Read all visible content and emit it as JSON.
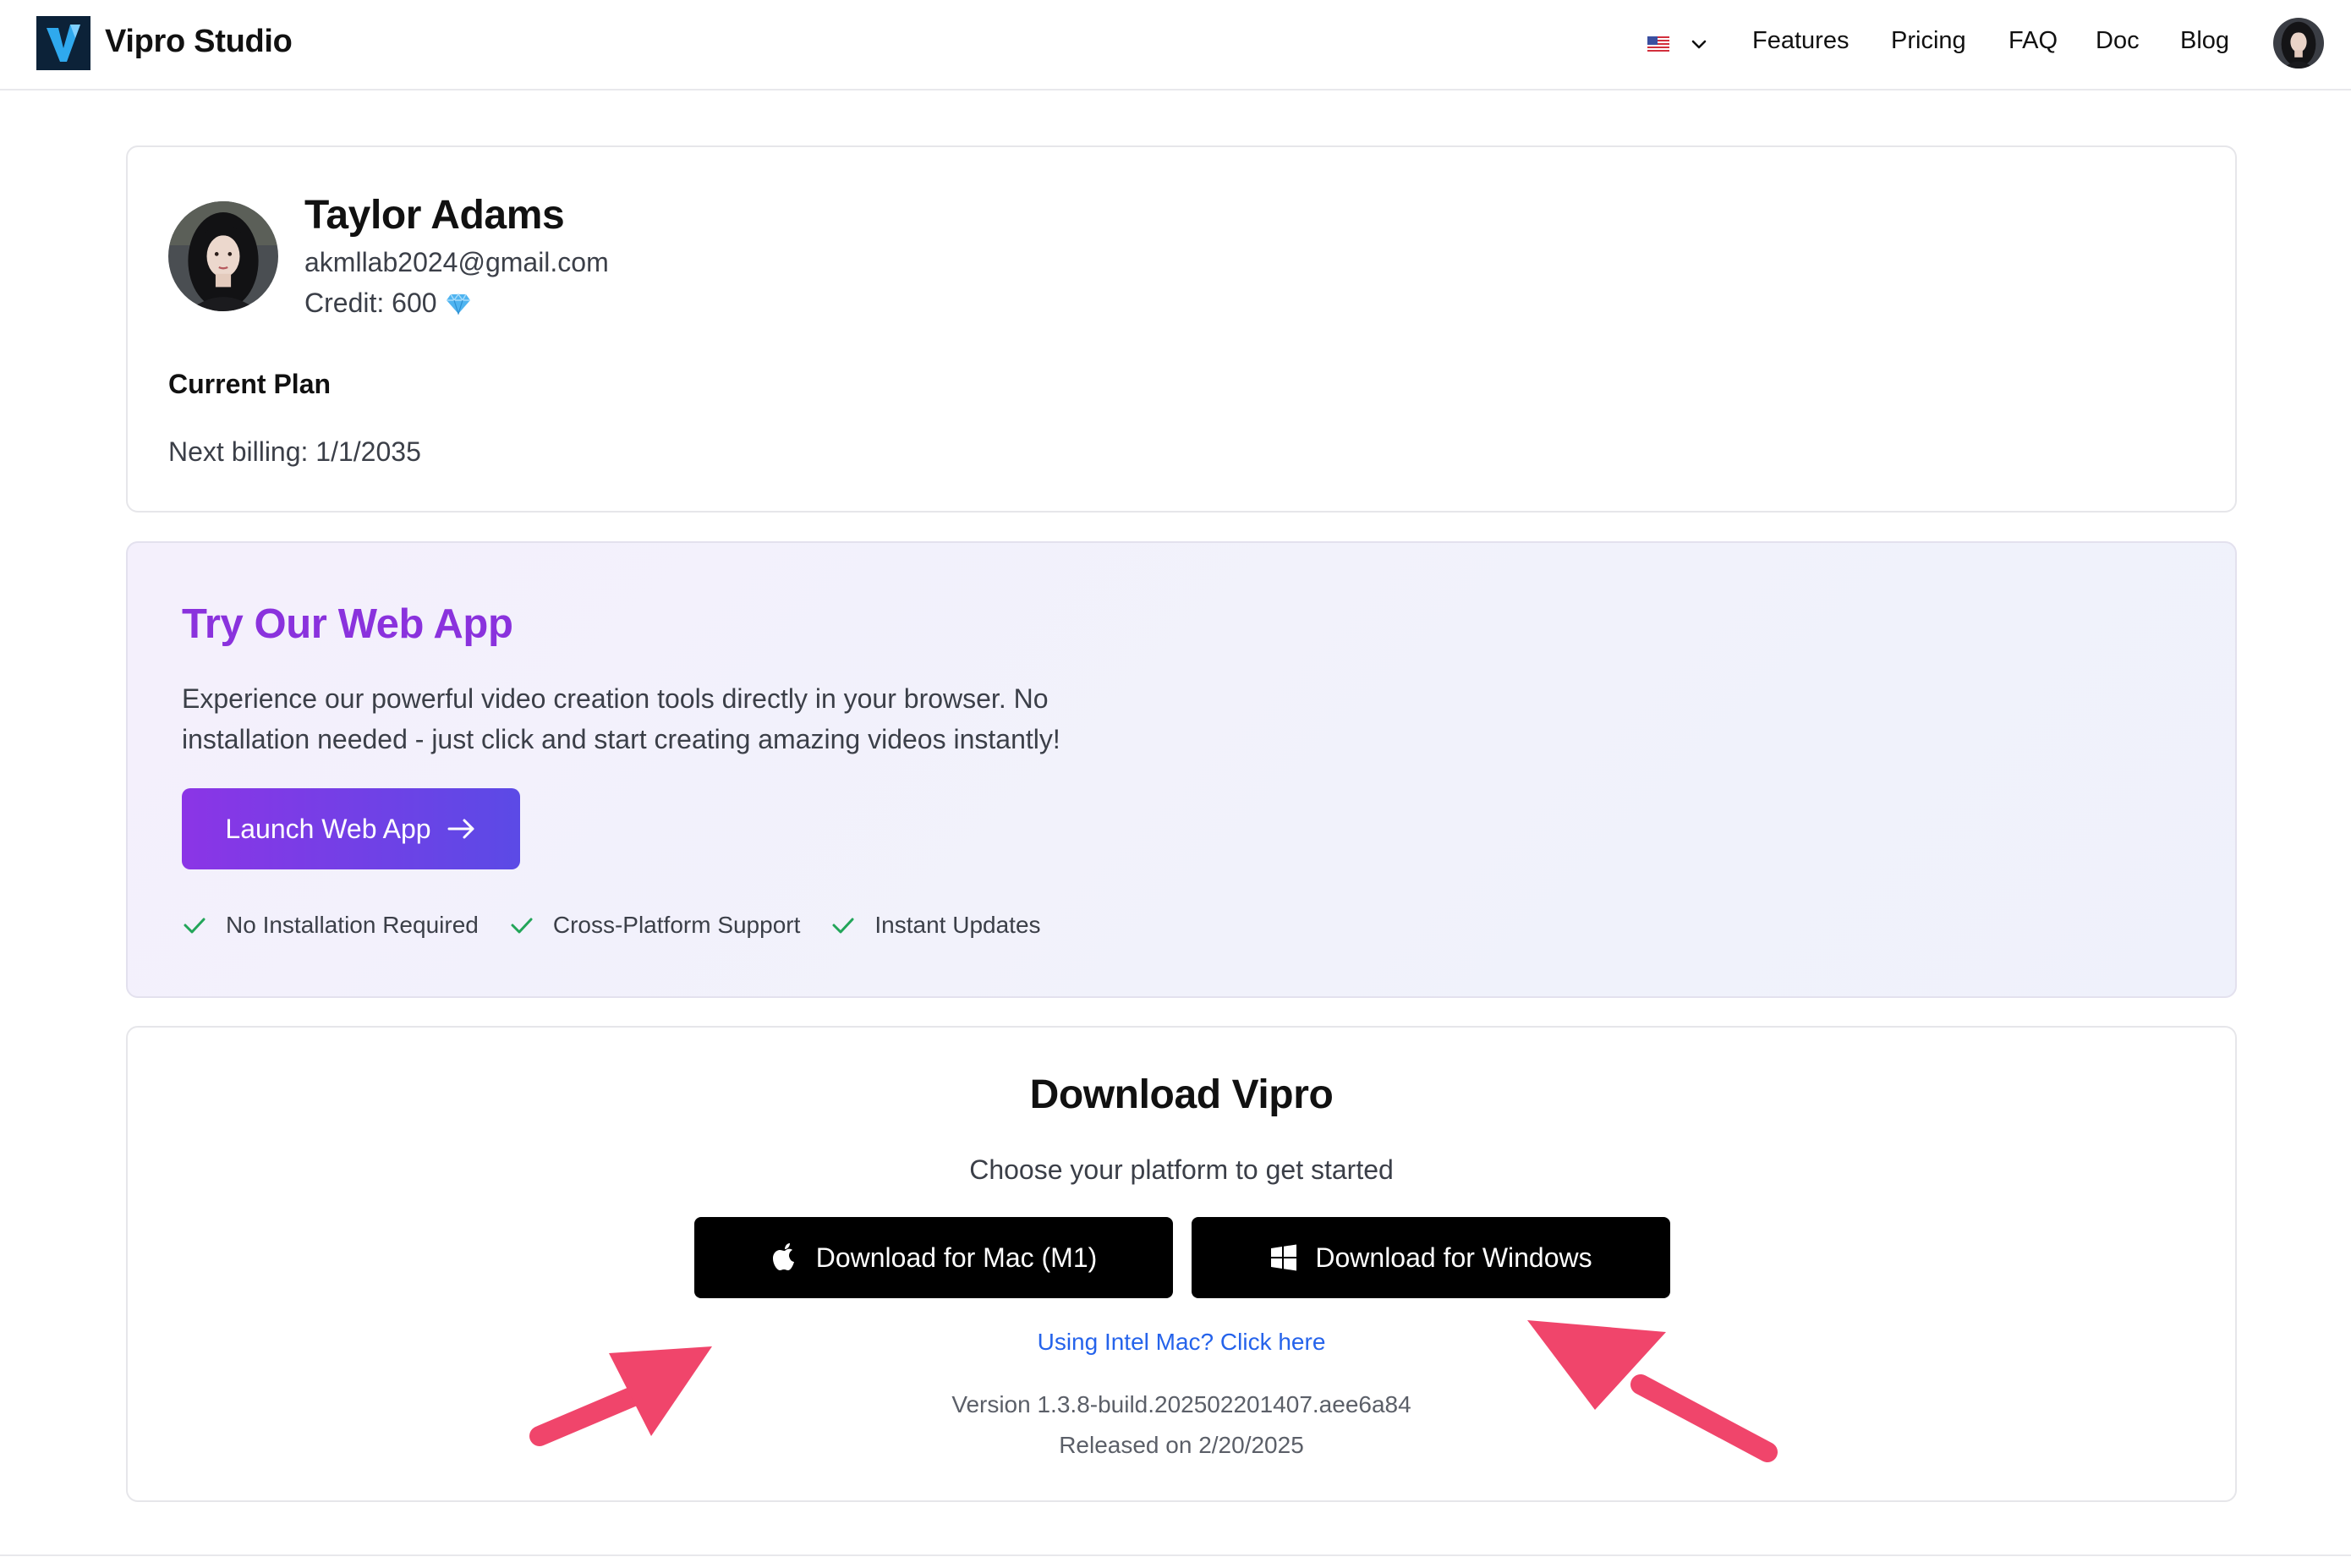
{
  "header": {
    "brand": "Vipro Studio",
    "language_flag": "us-flag-icon",
    "nav": [
      "Features",
      "Pricing",
      "FAQ",
      "Doc",
      "Blog"
    ]
  },
  "profile": {
    "name": "Taylor Adams",
    "email": "akmllab2024@gmail.com",
    "credit_label": "Credit: 600",
    "credit_icon": "diamond-icon",
    "plan_title": "Current Plan",
    "next_billing": "Next billing: 1/1/2035"
  },
  "webapp": {
    "title": "Try Our Web App",
    "description": "Experience our powerful video creation tools directly in your browser. No installation needed - just click and start creating amazing videos instantly!",
    "launch_label": "Launch Web App",
    "features": [
      "No Installation Required",
      "Cross-Platform Support",
      "Instant Updates"
    ]
  },
  "download": {
    "title": "Download Vipro",
    "subtitle": "Choose your platform to get started",
    "mac_label": "Download for Mac (M1)",
    "windows_label": "Download for Windows",
    "intel_link": "Using Intel Mac? Click here",
    "version": "Version 1.3.8-build.202502201407.aee6a84",
    "released": "Released on 2/20/2025"
  },
  "colors": {
    "accent_purple": "#8a32dd",
    "button_gradient_start": "#8b35e6",
    "button_gradient_end": "#5b4ae6",
    "link_blue": "#2563eb",
    "check_green": "#22a559",
    "annotation_arrow": "#f0456b"
  }
}
